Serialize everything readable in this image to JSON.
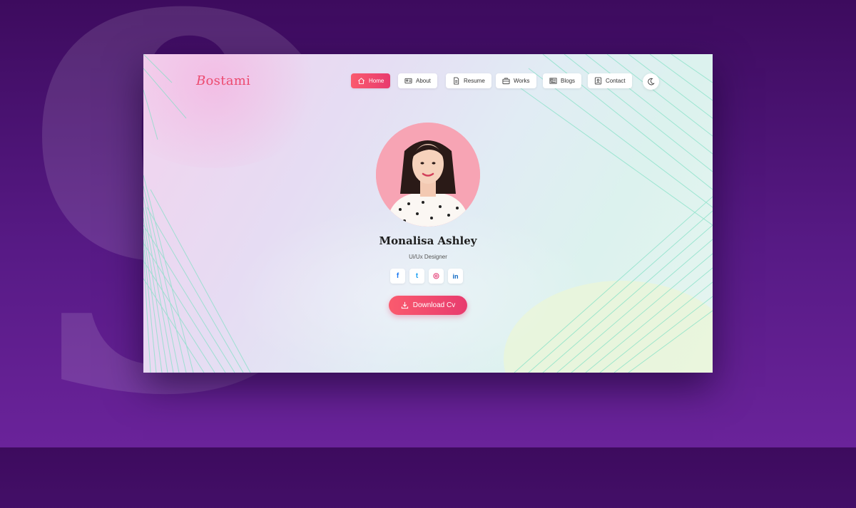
{
  "logo": {
    "initial": "B",
    "rest": "ostami"
  },
  "nav": {
    "items": [
      {
        "label": "Home",
        "icon": "home-icon"
      },
      {
        "label": "About",
        "icon": "id-card-icon"
      },
      {
        "label": "Resume",
        "icon": "document-icon"
      },
      {
        "label": "Works",
        "icon": "briefcase-icon"
      },
      {
        "label": "Blogs",
        "icon": "newspaper-icon"
      },
      {
        "label": "Contact",
        "icon": "contact-icon"
      }
    ],
    "active": "Home",
    "theme_toggle": "moon-icon"
  },
  "profile": {
    "name": "Monalisa Ashley",
    "role": "Ui/Ux Designer",
    "socials": [
      {
        "icon": "facebook-icon",
        "glyph": "f",
        "color": "#1877f2"
      },
      {
        "icon": "twitter-icon",
        "glyph": "t",
        "color": "#1da1f2"
      },
      {
        "icon": "instagram-icon",
        "glyph": "◎",
        "color": "#e1306c"
      },
      {
        "icon": "linkedin-icon",
        "glyph": "in",
        "color": "#0a66c2"
      }
    ],
    "cv_button": "Download Cv"
  },
  "background_glyph": "9",
  "colors": {
    "accent": "#ec4a6f",
    "background": "#571a85"
  }
}
